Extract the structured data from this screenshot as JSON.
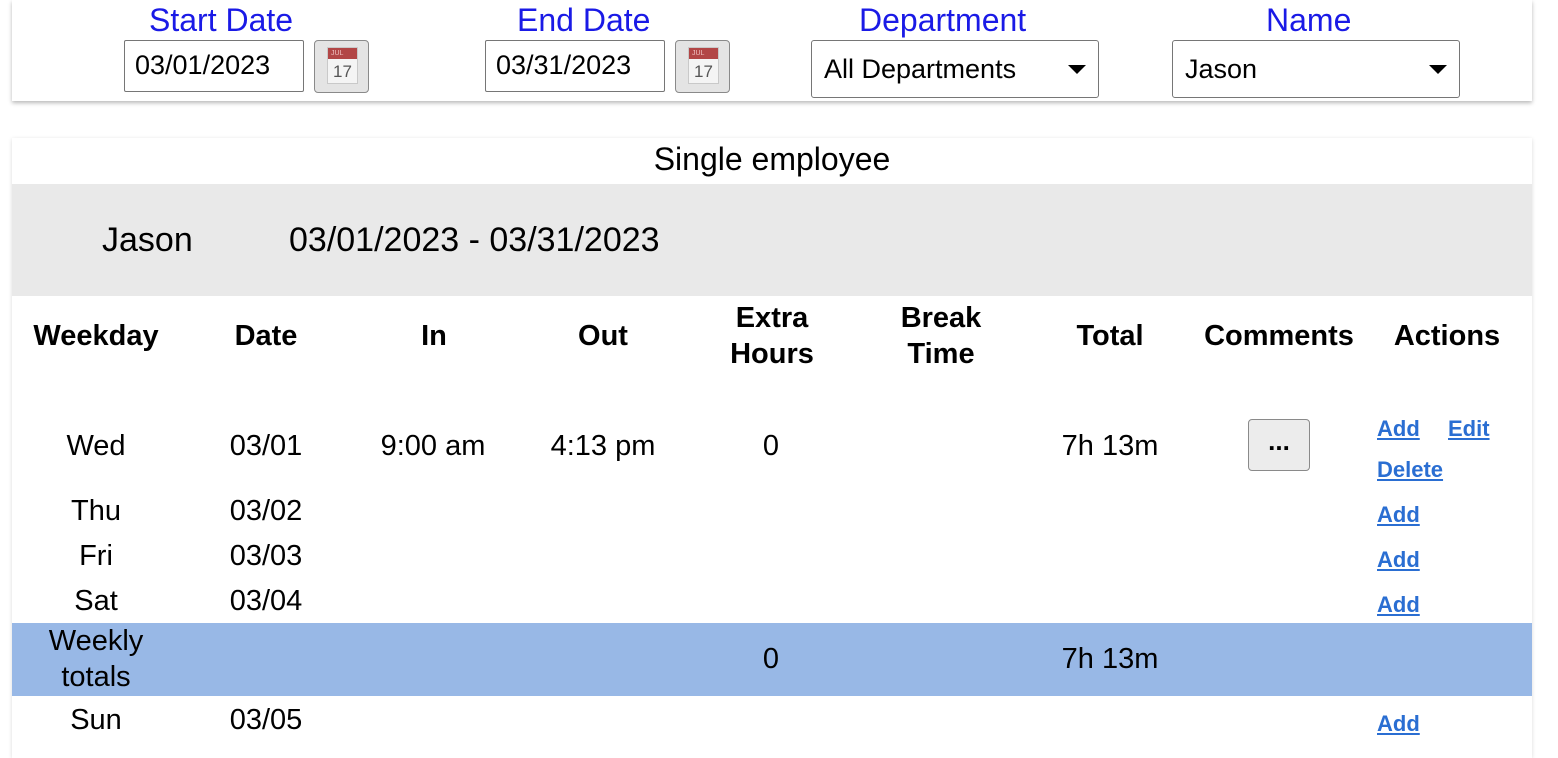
{
  "filters": {
    "start_date": {
      "label": "Start Date",
      "value": "03/01/2023",
      "calendar_day": "17",
      "calendar_month": "JUL"
    },
    "end_date": {
      "label": "End Date",
      "value": "03/31/2023",
      "calendar_day": "17",
      "calendar_month": "JUL"
    },
    "department": {
      "label": "Department",
      "selected": "All Departments"
    },
    "name": {
      "label": "Name",
      "selected": "Jason"
    }
  },
  "report": {
    "title": "Single employee",
    "employee_name": "Jason",
    "date_range": "03/01/2023 - 03/31/2023",
    "columns": {
      "weekday": "Weekday",
      "date": "Date",
      "in": "In",
      "out": "Out",
      "extra_hours_1": "Extra",
      "extra_hours_2": "Hours",
      "break_time_1": "Break",
      "break_time_2": "Time",
      "total": "Total",
      "comments": "Comments",
      "actions": "Actions"
    },
    "rows": [
      {
        "weekday": "Wed",
        "date": "03/01",
        "in": "9:00 am",
        "out": "4:13 pm",
        "extra": "0",
        "total": "7h 13m",
        "comment_button": "...",
        "actions": [
          "Add",
          "Edit",
          "Delete"
        ]
      },
      {
        "weekday": "Thu",
        "date": "03/02",
        "actions": [
          "Add"
        ]
      },
      {
        "weekday": "Fri",
        "date": "03/03",
        "actions": [
          "Add"
        ]
      },
      {
        "weekday": "Sat",
        "date": "03/04",
        "actions": [
          "Add"
        ]
      },
      {
        "weekday": "Sun",
        "date": "03/05",
        "actions": [
          "Add"
        ]
      }
    ],
    "weekly_totals": {
      "label_1": "Weekly",
      "label_2": "totals",
      "extra": "0",
      "total": "7h 13m"
    }
  },
  "colors": {
    "label_blue": "#1a1ae6",
    "link_blue": "#2a6ed2",
    "weekly_band": "#98b8e6",
    "employee_band": "#e9e9e9",
    "calendar_red": "#b24646"
  }
}
